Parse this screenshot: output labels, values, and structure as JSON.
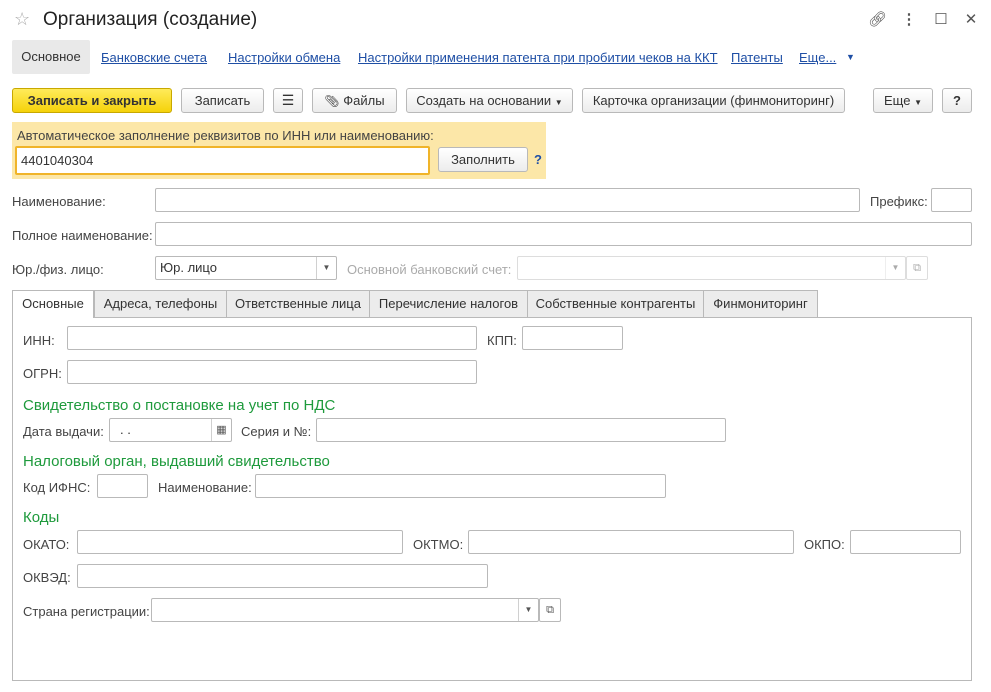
{
  "window": {
    "title": "Организация (создание)"
  },
  "nav": {
    "active": "Основное",
    "links": [
      "Банковские счета",
      "Настройки обмена",
      "Настройки применения патента при пробитии чеков на ККТ",
      "Патенты",
      "Еще..."
    ]
  },
  "toolbar": {
    "save_close": "Записать и закрыть",
    "save": "Записать",
    "files": "Файлы",
    "create_based": "Создать на основании",
    "org_card": "Карточка организации (финмониторинг)",
    "more": "Еще",
    "help": "?"
  },
  "autofill": {
    "label": "Автоматическое заполнение реквизитов по ИНН или наименованию:",
    "value": "4401040304",
    "fill_button": "Заполнить",
    "help": "?"
  },
  "form": {
    "name_label": "Наименование:",
    "prefix_label": "Префикс:",
    "full_name_label": "Полное наименование:",
    "entity_label": "Юр./физ. лицо:",
    "entity_value": "Юр. лицо",
    "bank_label": "Основной банковский счет:"
  },
  "tabs": [
    "Основные",
    "Адреса, телефоны",
    "Ответственные лица",
    "Перечисление налогов",
    "Собственные контрагенты",
    "Финмониторинг"
  ],
  "basic": {
    "inn_label": "ИНН:",
    "kpp_label": "КПП:",
    "ogrn_label": "ОГРН:",
    "vat_section": "Свидетельство о постановке на учет по НДС",
    "issue_date_label": "Дата выдачи:",
    "issue_date_value": " .  .",
    "series_label": "Серия и №:",
    "tax_section": "Налоговый орган, выдавший свидетельство",
    "ifns_label": "Код ИФНС:",
    "tax_name_label": "Наименование:",
    "codes_section": "Коды",
    "okato_label": "ОКАТО:",
    "oktmo_label": "ОКТМО:",
    "okpo_label": "ОКПО:",
    "okved_label": "ОКВЭД:",
    "country_label": "Страна регистрации:"
  },
  "colors": {
    "primary_button": "#f5d20a",
    "section_heading": "#1e9a3c",
    "link": "#1f4fa5",
    "autofill_bg": "#fce7a8",
    "focus_border": "#f0b429"
  }
}
